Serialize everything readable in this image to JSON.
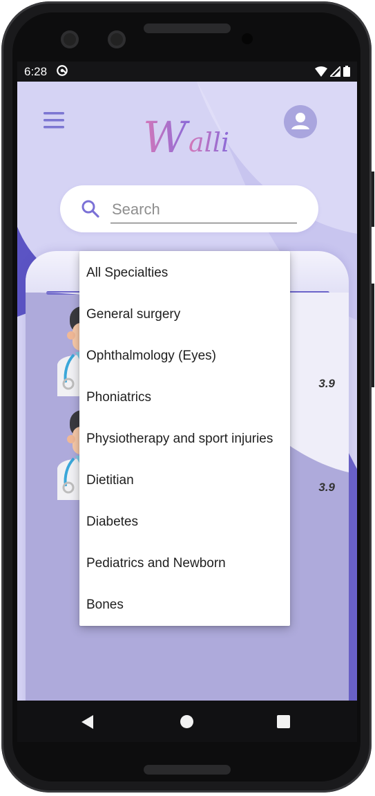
{
  "status_bar": {
    "time": "6:28"
  },
  "app": {
    "logo_text": "Walli",
    "search": {
      "placeholder": "Search",
      "value": ""
    },
    "colors": {
      "brand_purple": "#6b63c9",
      "logo_pink": "#c77bc8",
      "background_lavender": "#cfcdf1",
      "avatar": "#a9a5de"
    }
  },
  "doctors": [
    {
      "rating": "3.9"
    },
    {
      "rating": "3.9"
    }
  ],
  "specialty_dropdown": {
    "options": [
      "All Specialties",
      "General surgery",
      "Ophthalmology (Eyes)",
      "Phoniatrics",
      "Physiotherapy and sport injuries",
      "Dietitian",
      "Diabetes",
      "Pediatrics and Newborn",
      "Bones"
    ]
  },
  "icons": {
    "menu": "hamburger-menu-icon",
    "profile": "user-avatar-icon",
    "search": "search-icon",
    "nav_back": "back-triangle-icon",
    "nav_home": "home-circle-icon",
    "nav_recent": "recents-square-icon"
  }
}
